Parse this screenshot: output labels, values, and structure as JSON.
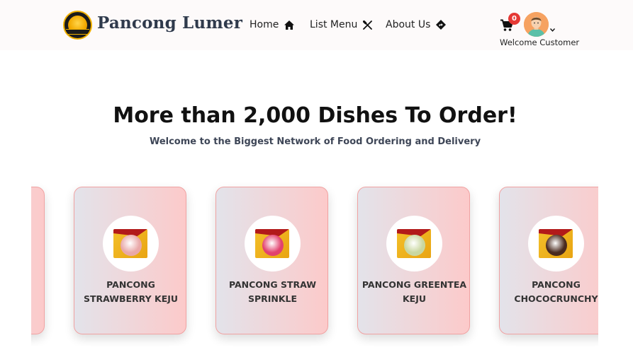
{
  "navbar": {
    "brand": "Pancong Lumer",
    "links": [
      {
        "label": "Home",
        "icon": "home-icon"
      },
      {
        "label": "List Menu",
        "icon": "utensils-icon"
      },
      {
        "label": "About Us",
        "icon": "directions-icon"
      }
    ],
    "cart_count": "0",
    "welcome": "Welcome Customer"
  },
  "hero": {
    "title": "More than 2,000 Dishes To Order!",
    "subtitle": "Welcome to the Biggest Network of Food Ordering and Delivery"
  },
  "menu_items": [
    {
      "name": "PANCONG STRAWBERRY KEJU",
      "topping_color": "#e9a8a8"
    },
    {
      "name": "PANCONG STRAW SPRINKLE",
      "topping_color": "#e2416e"
    },
    {
      "name": "PANCONG GREENTEA KEJU",
      "topping_color": "#c9d7a0"
    },
    {
      "name": "PANCONG CHOCOCRUNCHY",
      "topping_color": "#4a2a1e"
    }
  ],
  "colors": {
    "card_border": "#f0a2a2",
    "badge": "#e53935",
    "brand_text": "#2f3a4c"
  }
}
